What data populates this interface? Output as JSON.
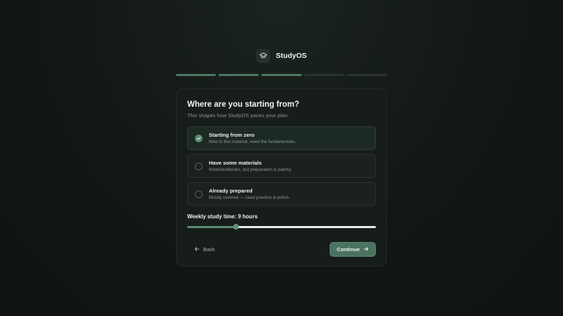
{
  "brand": {
    "name": "StudyOS",
    "icon": "graduation-cap-icon"
  },
  "progress": {
    "total_steps": 5,
    "completed_steps": 3
  },
  "card": {
    "title": "Where are you starting from?",
    "subtitle": "This shapes how StudyOS paces your plan.",
    "options": [
      {
        "label": "Starting from zero",
        "description": "New to this material, need the fundamentals.",
        "selected": true
      },
      {
        "label": "Have some materials",
        "description": "Notes/textbooks, but preparation is patchy.",
        "selected": false
      },
      {
        "label": "Already prepared",
        "description": "Mostly covered — need practice & polish.",
        "selected": false
      }
    ],
    "slider": {
      "label": "Weekly study time: 9 hours",
      "fraction": 0.26
    },
    "back_label": "Back",
    "continue_label": "Continue"
  },
  "colors": {
    "accent": "#5b8a73",
    "background": "#121714",
    "card": "#171d1a"
  }
}
